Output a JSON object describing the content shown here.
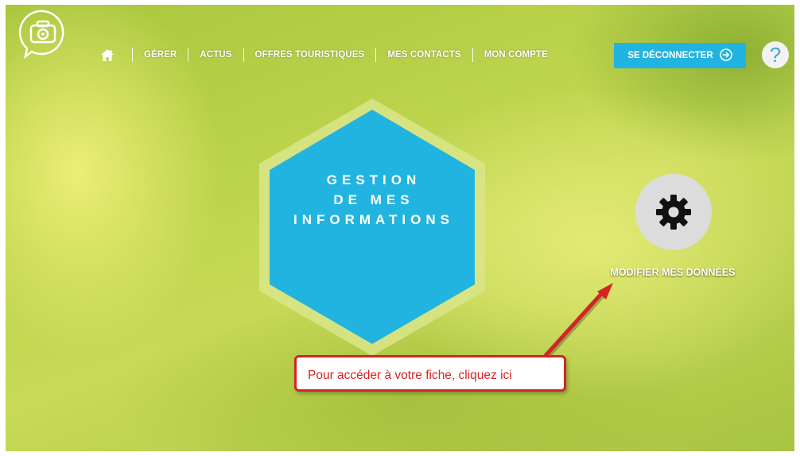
{
  "header": {
    "logo_icon": "camera-chat-bubble-icon",
    "home_icon": "home-icon",
    "nav_items": [
      {
        "label": "GÉRER"
      },
      {
        "label": "ACTUS"
      },
      {
        "label": "OFFRES TOURISTIQUES"
      },
      {
        "label": "MES CONTACTS"
      },
      {
        "label": "MON COMPTE"
      }
    ],
    "logout": {
      "label": "SE DÉCONNECTER",
      "icon": "arrow-right-circle-icon"
    },
    "help": {
      "label": "?"
    }
  },
  "main": {
    "hexagon": {
      "line1": "GESTION",
      "line2": "DE MES",
      "line3": "INFORMATIONS"
    },
    "action": {
      "icon": "gear-icon",
      "label": "MODIFIER MES DONNÉES"
    }
  },
  "annotation": {
    "text": "Pour accéder à votre fiche, cliquez ici"
  },
  "colors": {
    "accent_blue": "#22b4e0",
    "hexagon_border": "#d9e58a",
    "annotation_red": "#d42424"
  }
}
